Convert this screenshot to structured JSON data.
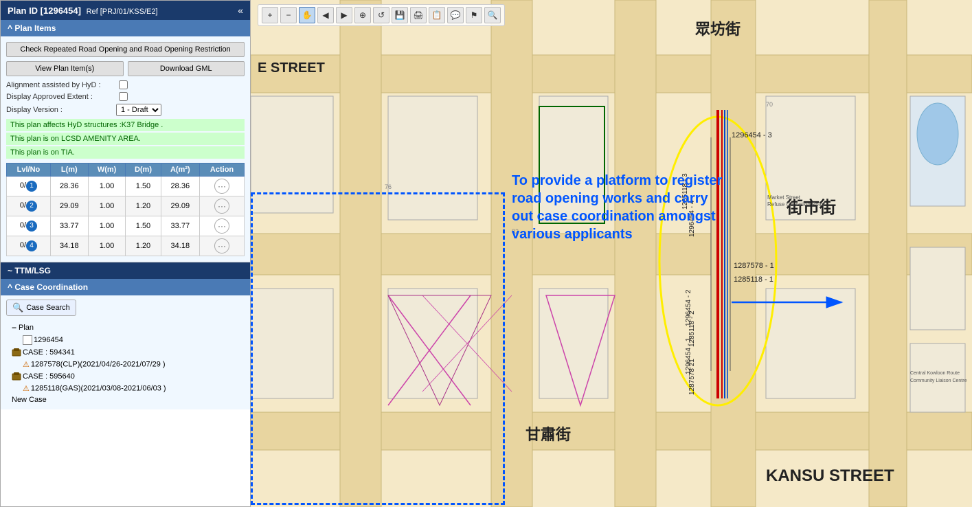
{
  "header": {
    "title": "Plan ID [1296454]",
    "ref": "Ref [PRJ/01/KSS/E2]",
    "collapse_label": "«"
  },
  "plan_items": {
    "section_label": "^ Plan Items",
    "check_btn": "Check Repeated Road Opening and Road Opening Restriction",
    "view_btn": "View Plan Item(s)",
    "download_btn": "Download GML",
    "alignment_label": "Alignment assisted by HyD :",
    "display_approved_label": "Display Approved Extent :",
    "display_version_label": "Display Version :",
    "version_options": [
      "1 - Draft"
    ],
    "version_selected": "1 - Draft",
    "info_lines": [
      "This plan affects HyD structures :K37 Bridge .",
      "This plan is on LCSD AMENITY AREA.",
      "This plan is on TIA."
    ],
    "table": {
      "columns": [
        "Lvl/No",
        "L(m)",
        "W(m)",
        "D(m)",
        "A(m²)",
        "Action"
      ],
      "rows": [
        {
          "lvl": "0/",
          "num": "1",
          "l": "28.36",
          "w": "1.00",
          "d": "1.50",
          "a": "28.36"
        },
        {
          "lvl": "0/",
          "num": "2",
          "l": "29.09",
          "w": "1.00",
          "d": "1.20",
          "a": "29.09"
        },
        {
          "lvl": "0/",
          "num": "3",
          "l": "33.77",
          "w": "1.00",
          "d": "1.50",
          "a": "33.77"
        },
        {
          "lvl": "0/",
          "num": "4",
          "l": "34.18",
          "w": "1.00",
          "d": "1.20",
          "a": "34.18"
        }
      ]
    }
  },
  "ttm_lsg": {
    "label": "~ TTM/LSG"
  },
  "case_coordination": {
    "label": "^ Case Coordination",
    "search_btn": "Case Search",
    "tree": [
      {
        "level": 0,
        "icon": "minus",
        "text": "Plan",
        "type": "header"
      },
      {
        "level": 1,
        "icon": "plan",
        "text": "1296454",
        "type": "plan"
      },
      {
        "level": 0,
        "icon": "minus",
        "text": "CASE : 594341",
        "type": "case"
      },
      {
        "level": 1,
        "icon": "warn",
        "text": "1287578(CLP)(2021/04/26-2021/07/29 )",
        "type": "warn"
      },
      {
        "level": 0,
        "icon": "minus",
        "text": "CASE : 595640",
        "type": "case"
      },
      {
        "level": 1,
        "icon": "warn",
        "text": "1285118(GAS)(2021/03/08-2021/06/03 )",
        "type": "warn"
      },
      {
        "level": 0,
        "icon": "none",
        "text": "New Case",
        "type": "plain"
      }
    ]
  },
  "toolbar": {
    "buttons": [
      {
        "name": "zoom-in",
        "icon": "🔍+",
        "label": "+"
      },
      {
        "name": "zoom-out",
        "icon": "🔍-",
        "label": "−"
      },
      {
        "name": "pan",
        "icon": "✋",
        "label": "✋"
      },
      {
        "name": "back",
        "icon": "◀",
        "label": "◀"
      },
      {
        "name": "forward",
        "icon": "▶",
        "label": "▶"
      },
      {
        "name": "select",
        "icon": "⊕",
        "label": "⊕"
      },
      {
        "name": "refresh",
        "icon": "↺",
        "label": "↺"
      },
      {
        "name": "floppy",
        "icon": "💾",
        "label": "💾"
      },
      {
        "name": "print",
        "icon": "🖨",
        "label": "🖨"
      },
      {
        "name": "copy",
        "icon": "📋",
        "label": "📋"
      },
      {
        "name": "comment",
        "icon": "💬",
        "label": "💬"
      },
      {
        "name": "flag",
        "icon": "⚑",
        "label": "⚑"
      },
      {
        "name": "search-map",
        "icon": "🔍",
        "label": "🔍"
      }
    ]
  },
  "annotation": {
    "text": "To provide a platform to register road opening works and carry out case coordination amongst various applicants"
  },
  "map_labels": {
    "street1": "眾坊街",
    "street2": "街市街",
    "street3": "甘肅街",
    "street4": "KANSU STREET",
    "street5": "E STREET",
    "ids": [
      "1296454 - 3",
      "1285118 - 3",
      "1296454 - 4",
      "1287578 - 1",
      "1285118 - 1",
      "1296454 - 2",
      "1285118 - 2",
      "1296454 - 1",
      "1287578 21"
    ]
  },
  "colors": {
    "panel_bg": "#f0f8ff",
    "header_bg": "#1a3a6b",
    "section_bg": "#4a7ab5",
    "green_info": "#ccffcc",
    "dashed_border": "#0055ff",
    "annotation_text": "#0055ff",
    "arrow_color": "#0055ff"
  }
}
